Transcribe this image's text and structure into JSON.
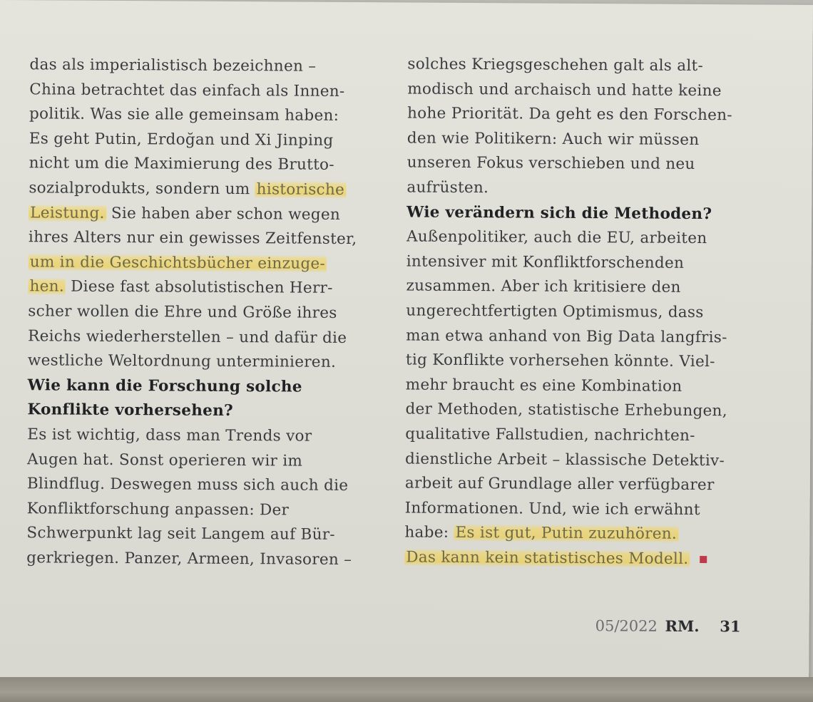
{
  "left_column": {
    "lines": [
      {
        "segments": [
          {
            "text": "das als imperialistisch bezeichnen –"
          }
        ]
      },
      {
        "segments": [
          {
            "text": "China betrachtet das einfach als Innen-"
          }
        ]
      },
      {
        "segments": [
          {
            "text": "politik. Was sie alle gemeinsam haben:"
          }
        ]
      },
      {
        "segments": [
          {
            "text": "Es geht Putin, Erdoğan und Xi Jinping"
          }
        ]
      },
      {
        "segments": [
          {
            "text": "nicht um die Maximierung des Brutto-"
          }
        ]
      },
      {
        "segments": [
          {
            "text": "sozialprodukts, sondern um "
          },
          {
            "text": "historische",
            "highlight": true
          }
        ]
      },
      {
        "segments": [
          {
            "text": "Leistung.",
            "highlight": true
          },
          {
            "text": " Sie haben aber schon wegen"
          }
        ]
      },
      {
        "segments": [
          {
            "text": "ihres Alters nur ein gewisses Zeitfenster,"
          }
        ]
      },
      {
        "segments": [
          {
            "text": "um in die Geschichtsbücher einzuge-",
            "highlight": true
          }
        ]
      },
      {
        "segments": [
          {
            "text": "hen.",
            "highlight": true
          },
          {
            "text": " Diese fast absolutistischen Herr-"
          }
        ]
      },
      {
        "segments": [
          {
            "text": "scher wollen die Ehre und Größe ihres"
          }
        ]
      },
      {
        "segments": [
          {
            "text": "Reichs wiederherstellen – und dafür die"
          }
        ]
      },
      {
        "segments": [
          {
            "text": "westliche Weltordnung unterminieren."
          }
        ]
      },
      {
        "question": true,
        "segments": [
          {
            "text": "Wie kann die Forschung solche"
          }
        ]
      },
      {
        "question": true,
        "segments": [
          {
            "text": "Konflikte vorhersehen?"
          }
        ]
      },
      {
        "segments": [
          {
            "text": "Es ist wichtig, dass man Trends vor"
          }
        ]
      },
      {
        "segments": [
          {
            "text": "Augen hat. Sonst operieren wir im"
          }
        ]
      },
      {
        "segments": [
          {
            "text": "Blindflug. Deswegen muss sich auch die"
          }
        ]
      },
      {
        "segments": [
          {
            "text": "Konfliktforschung anpassen: Der"
          }
        ]
      },
      {
        "segments": [
          {
            "text": "Schwerpunkt lag seit Langem auf Bür-"
          }
        ]
      },
      {
        "segments": [
          {
            "text": "gerkriegen. Panzer, Armeen, Invasoren –"
          }
        ]
      }
    ]
  },
  "right_column": {
    "lines": [
      {
        "segments": [
          {
            "text": "solches Kriegsgeschehen galt als alt-"
          }
        ]
      },
      {
        "segments": [
          {
            "text": "modisch und archaisch und hatte keine"
          }
        ]
      },
      {
        "segments": [
          {
            "text": "hohe Priorität. Da geht es den Forschen-"
          }
        ]
      },
      {
        "segments": [
          {
            "text": "den wie Politikern: Auch wir müssen"
          }
        ]
      },
      {
        "segments": [
          {
            "text": "unseren Fokus verschieben und neu"
          }
        ]
      },
      {
        "segments": [
          {
            "text": "aufrüsten."
          }
        ]
      },
      {
        "question": true,
        "segments": [
          {
            "text": "Wie verändern sich die Methoden?"
          }
        ]
      },
      {
        "segments": [
          {
            "text": "Außenpolitiker, auch die EU, arbeiten"
          }
        ]
      },
      {
        "segments": [
          {
            "text": "intensiver mit Konfliktforschenden"
          }
        ]
      },
      {
        "segments": [
          {
            "text": "zusammen. Aber ich kritisiere den"
          }
        ]
      },
      {
        "segments": [
          {
            "text": "ungerechtfertigten Optimismus, dass"
          }
        ]
      },
      {
        "segments": [
          {
            "text": "man etwa anhand von Big Data langfris-"
          }
        ]
      },
      {
        "segments": [
          {
            "text": "tig Konflikte vorhersehen könnte. Viel-"
          }
        ]
      },
      {
        "segments": [
          {
            "text": "mehr braucht es eine Kombination"
          }
        ]
      },
      {
        "segments": [
          {
            "text": "der Methoden, statistische Erhebungen,"
          }
        ]
      },
      {
        "segments": [
          {
            "text": "qualitative Fallstudien, nachrichten-"
          }
        ]
      },
      {
        "segments": [
          {
            "text": "dienstliche Arbeit – klassische Detektiv-"
          }
        ]
      },
      {
        "segments": [
          {
            "text": "arbeit auf Grundlage aller verfügbarer"
          }
        ]
      },
      {
        "segments": [
          {
            "text": "Informationen. Und, wie ich erwähnt"
          }
        ]
      },
      {
        "segments": [
          {
            "text": "habe: "
          },
          {
            "text": "Es ist gut, Putin zuzuhören.",
            "highlight": true
          }
        ]
      },
      {
        "end_mark": true,
        "segments": [
          {
            "text": "Das kann kein statistisches Modell.",
            "highlight": true
          }
        ]
      }
    ]
  },
  "footer": {
    "issue": "05/2022",
    "magazine": "RM.",
    "page_number": "31"
  },
  "colors": {
    "highlight": "#f2d24e",
    "end_mark": "#c0394a",
    "text": "#3a3c40"
  }
}
